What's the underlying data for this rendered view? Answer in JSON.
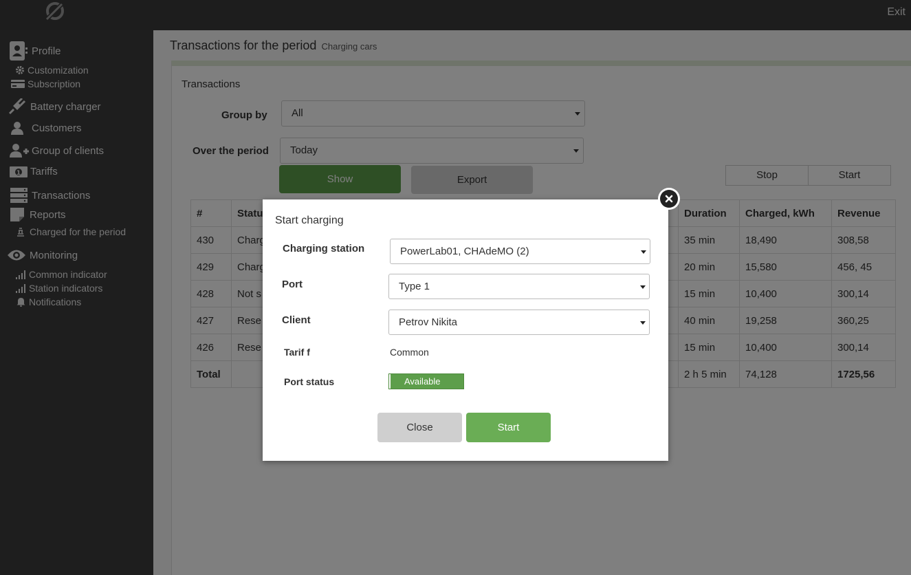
{
  "topbar": {
    "exit_label": "Exit"
  },
  "sidebar": {
    "profile": "Profile",
    "customization": "Customization",
    "subscription": "Subscription",
    "battery_charger": "Battery charger",
    "customers": "Customers",
    "group_of_clients": "Group of clients",
    "tariffs": "Tariffs",
    "transactions": "Transactions",
    "reports": "Reports",
    "charged_for_period": "Charged for the period",
    "monitoring": "Monitoring",
    "common_indicator": "Common indicator",
    "station_indicators": "Station indicators",
    "notifications": "Notifications"
  },
  "main": {
    "title": "Transactions for the period",
    "subtitle": "Charging cars",
    "panel_title": "Transactions",
    "group_by_label": "Group by",
    "group_by_value": "All",
    "period_label": "Over the period",
    "period_value": "Today",
    "show_label": "Show",
    "export_label": "Export",
    "stop_label": "Stop",
    "start_label": "Start"
  },
  "table": {
    "headers": [
      "#",
      "Status",
      "Duration",
      "Charged, kWh",
      "Revenue"
    ],
    "rows": [
      [
        "430",
        "Charg",
        "35 min",
        "18,490",
        "308,58"
      ],
      [
        "429",
        "Charg",
        "20 min",
        "15,580",
        "456, 45"
      ],
      [
        "428",
        "Not s",
        "15 min",
        "10,400",
        "300,14"
      ],
      [
        "427",
        "Rese",
        "40 min",
        "19,258",
        "360,25"
      ],
      [
        "426",
        "Rese",
        "15 min",
        "10,400",
        "300,14"
      ]
    ],
    "total": [
      "Total",
      "",
      "2 h 5 min",
      "74,128",
      "1725,56"
    ]
  },
  "modal": {
    "title": "Start charging",
    "station_label": "Charging station",
    "station_value": "PowerLab01, CHAdeMO (2)",
    "port_label": "Port",
    "port_value": "Type 1",
    "client_label": "Client",
    "client_value": "Petrov Nikita",
    "tariff_label": "Tarif f",
    "tariff_value": "Common",
    "port_status_label": "Port status",
    "port_status_value": "Available",
    "close_label": "Close",
    "start_label": "Start"
  },
  "colors": {
    "topbar": "#3a3a3a",
    "sidebar": "#3c3c3c",
    "accent_green": "#6aad55",
    "overlay": "rgba(0,0,0,0.5)"
  }
}
